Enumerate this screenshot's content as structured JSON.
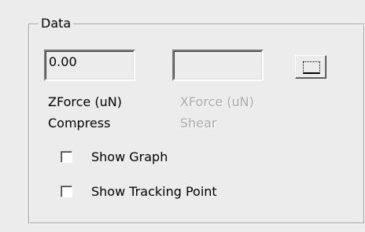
{
  "group": {
    "title": "Data"
  },
  "zforce": {
    "value": "0.00",
    "label": "ZForce (uN)",
    "sublabel": "Compress"
  },
  "xforce": {
    "value": "",
    "label": "XForce (uN)",
    "sublabel": "Shear"
  },
  "options": {
    "show_graph": "Show Graph",
    "show_tracking": "Show Tracking Point"
  },
  "colors": {
    "background": "#ececec",
    "disabled_text": "#a8a8a8"
  }
}
